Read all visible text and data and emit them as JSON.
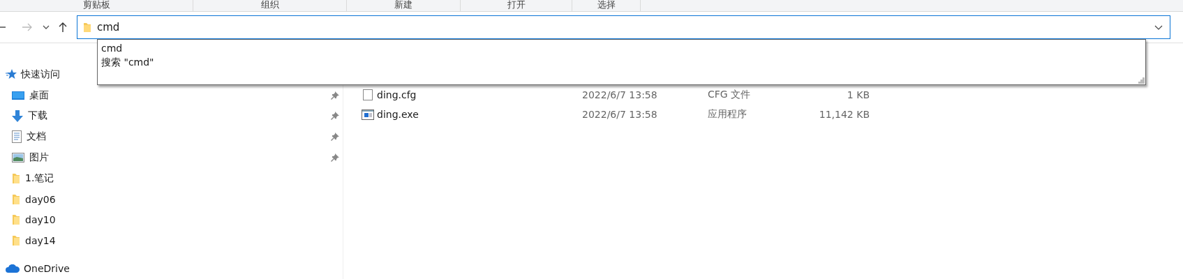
{
  "ribbon_groups": [
    {
      "label": "剪贴板"
    },
    {
      "label": "组织"
    },
    {
      "label": "新建"
    },
    {
      "label": "打开"
    },
    {
      "label": "选择"
    }
  ],
  "nav_buttons": [
    {
      "kind": "back",
      "disabled": false
    },
    {
      "kind": "forward",
      "disabled": true
    },
    {
      "kind": "recent",
      "disabled": false
    },
    {
      "kind": "up",
      "disabled": false
    }
  ],
  "address_bar": {
    "value": "cmd"
  },
  "autocomplete": {
    "items": [
      "cmd",
      "搜索 \"cmd\""
    ]
  },
  "sidebar": {
    "items": [
      {
        "kind": "quick_access",
        "label": "快速访问",
        "pinned": false
      },
      {
        "kind": "desktop",
        "label": "桌面",
        "pinned": true
      },
      {
        "kind": "downloads",
        "label": "下载",
        "pinned": true
      },
      {
        "kind": "documents",
        "label": "文档",
        "pinned": true
      },
      {
        "kind": "pictures",
        "label": "图片",
        "pinned": true
      },
      {
        "kind": "folder",
        "label": "1.笔记",
        "pinned": false
      },
      {
        "kind": "folder",
        "label": "day06",
        "pinned": false
      },
      {
        "kind": "folder",
        "label": "day10",
        "pinned": false
      },
      {
        "kind": "folder",
        "label": "day14",
        "pinned": false
      },
      {
        "kind": "onedrive",
        "label": "OneDrive",
        "pinned": false
      }
    ]
  },
  "files": [
    {
      "kind": "cfg",
      "name": "ding.cfg",
      "date": "2022/6/7 13:58",
      "type": "CFG 文件",
      "size": "1 KB"
    },
    {
      "kind": "exe",
      "name": "ding.exe",
      "date": "2022/6/7 13:58",
      "type": "应用程序",
      "size": "11,142 KB"
    }
  ]
}
